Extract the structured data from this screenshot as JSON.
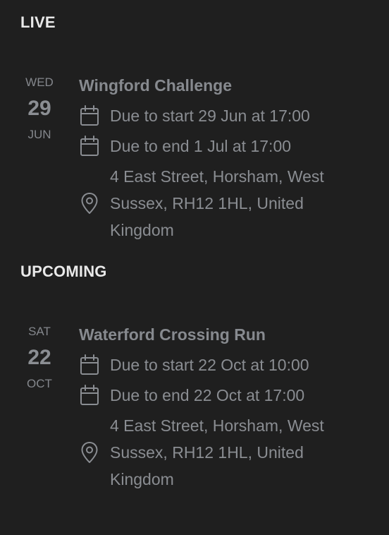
{
  "sections": [
    {
      "title": "LIVE",
      "event": {
        "date": {
          "dow": "WED",
          "day": "29",
          "month": "JUN"
        },
        "title": "Wingford Challenge",
        "start": "Due to start 29 Jun at 17:00",
        "end": "Due to end 1 Jul at 17:00",
        "address": "4 East Street, Horsham, West Sussex, RH12 1HL, United Kingdom"
      }
    },
    {
      "title": "UPCOMING",
      "event": {
        "date": {
          "dow": "SAT",
          "day": "22",
          "month": "OCT"
        },
        "title": "Waterford Crossing Run",
        "start": "Due to start 22 Oct at 10:00",
        "end": "Due to end 22 Oct at 17:00",
        "address": "4 East Street, Horsham, West Sussex, RH12 1HL, United Kingdom"
      }
    }
  ],
  "icons": {
    "start": "calendar-icon",
    "end": "calendar-icon",
    "address": "location-pin-icon"
  },
  "colors": {
    "background": "#1f1f1f",
    "heading": "#e9e9e9",
    "text": "#8a8d92"
  }
}
